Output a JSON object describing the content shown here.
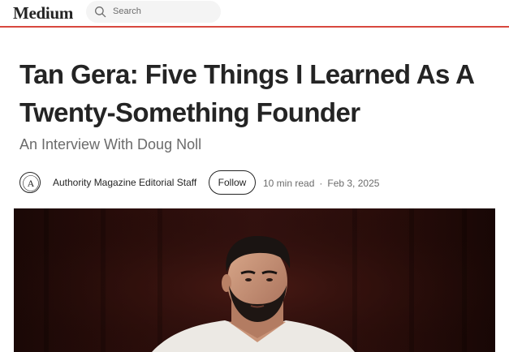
{
  "header": {
    "logo": "Medium",
    "search_placeholder": "Search",
    "accent_color": "#d8483e"
  },
  "article": {
    "title": "Tan Gera: Five Things I Learned As A Twenty-Something Founder",
    "subtitle": "An Interview With Doug Noll",
    "author": "Authority Magazine Editorial Staff",
    "avatar_letter": "A",
    "follow_label": "Follow",
    "read_time": "10 min read",
    "separator": "·",
    "date": "Feb 3, 2025",
    "hero_image": "portrait of a bearded man in a white shirt against a dark red curtain"
  }
}
